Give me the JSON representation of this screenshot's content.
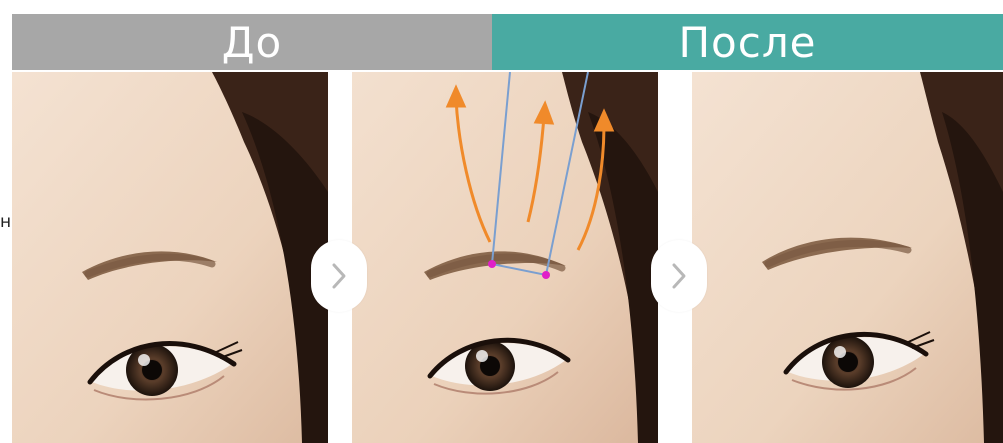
{
  "header": {
    "before_label": "До",
    "after_label": "После"
  },
  "stray_text": "н",
  "icons": {
    "next_arrow": "chevron-right-icon",
    "lift_arrow": "arrow-up-icon"
  },
  "colors": {
    "before_bar": "#a7a7a7",
    "after_bar": "#49aaa2",
    "arrows": "#f08a2a",
    "thread_lines": "#7a9fd0",
    "anchor_points": "#e020c8"
  }
}
